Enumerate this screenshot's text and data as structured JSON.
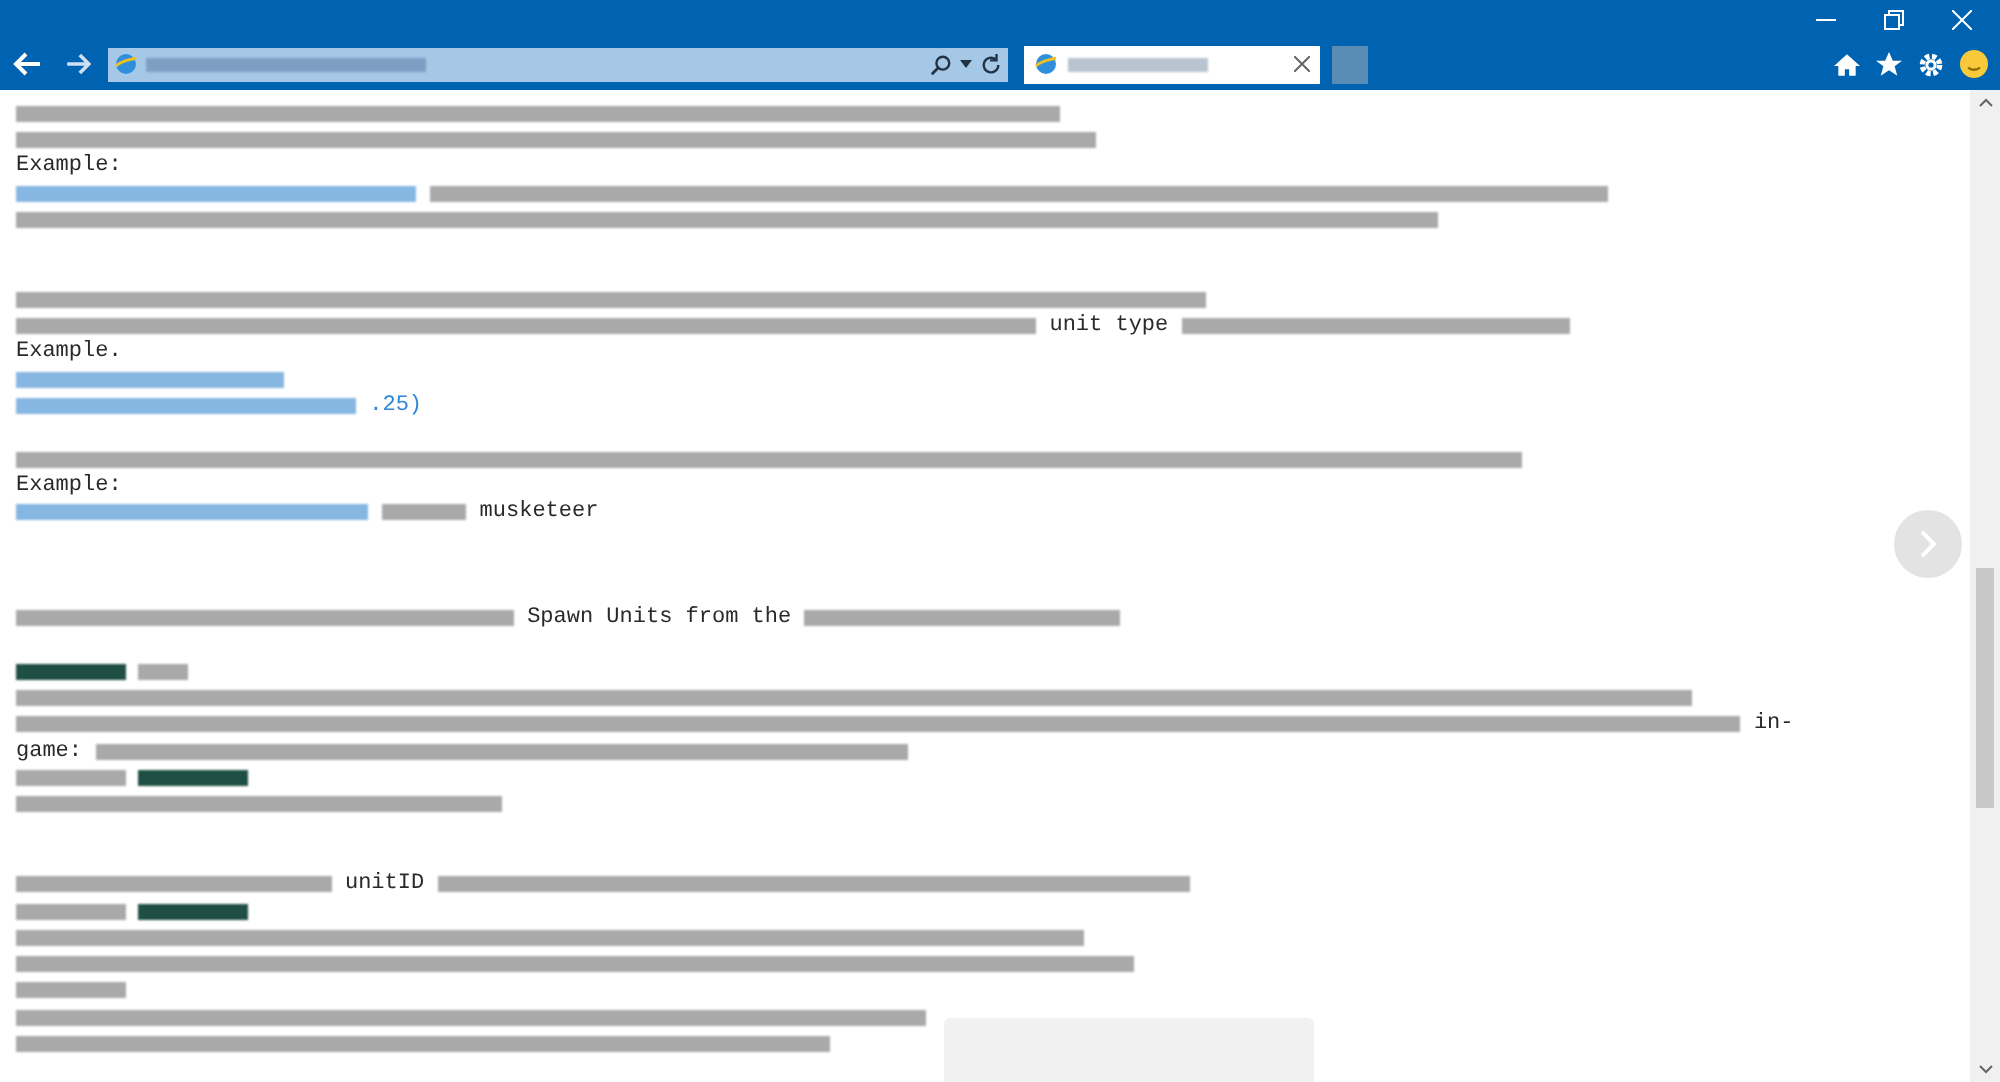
{
  "browser": {
    "tabs": [
      {
        "selected": true
      }
    ]
  },
  "document": {
    "lines": [
      {
        "kind": "code",
        "segments": [
          {
            "kind": "redacted",
            "link": false
          }
        ]
      },
      {
        "kind": "code",
        "segments": [
          {
            "kind": "redacted",
            "link": false
          }
        ]
      },
      {
        "kind": "code",
        "segments": [
          {
            "kind": "text",
            "link": false,
            "text": "Example:"
          }
        ]
      },
      {
        "kind": "code",
        "segments": [
          {
            "kind": "redacted",
            "link": true
          },
          {
            "kind": "redacted",
            "link": false
          }
        ]
      },
      {
        "kind": "code",
        "segments": [
          {
            "kind": "redacted",
            "link": false
          }
        ]
      },
      {
        "kind": "blank"
      },
      {
        "kind": "blank"
      },
      {
        "kind": "code",
        "segments": [
          {
            "kind": "redacted",
            "link": false
          }
        ]
      },
      {
        "kind": "code",
        "segments": [
          {
            "kind": "redacted",
            "link": false
          },
          {
            "kind": "text",
            "link": false,
            "text": "unit type"
          },
          {
            "kind": "redacted",
            "link": false
          }
        ]
      },
      {
        "kind": "code",
        "segments": [
          {
            "kind": "text",
            "link": false,
            "text": "Example."
          }
        ]
      },
      {
        "kind": "code",
        "segments": [
          {
            "kind": "redacted",
            "link": true
          }
        ]
      },
      {
        "kind": "code",
        "segments": [
          {
            "kind": "redacted",
            "link": true
          },
          {
            "kind": "text",
            "link": true,
            "text": ".25)"
          }
        ]
      },
      {
        "kind": "blank"
      },
      {
        "kind": "code",
        "segments": [
          {
            "kind": "redacted",
            "link": false
          }
        ]
      },
      {
        "kind": "code",
        "segments": [
          {
            "kind": "text",
            "link": false,
            "text": "Example:"
          }
        ]
      },
      {
        "kind": "code",
        "segments": [
          {
            "kind": "redacted",
            "link": true
          },
          {
            "kind": "redacted",
            "link": false
          },
          {
            "kind": "text",
            "link": false,
            "text": "musketeer"
          }
        ]
      },
      {
        "kind": "blank"
      },
      {
        "kind": "blank"
      },
      {
        "kind": "blank"
      },
      {
        "kind": "code",
        "segments": [
          {
            "kind": "redacted",
            "link": false
          },
          {
            "kind": "text",
            "link": false,
            "text": "Spawn Units from the"
          },
          {
            "kind": "redacted",
            "link": false
          }
        ]
      },
      {
        "kind": "blank"
      },
      {
        "kind": "code",
        "segments": [
          {
            "kind": "highlighted"
          },
          {
            "kind": "redacted",
            "link": false
          }
        ]
      },
      {
        "kind": "code",
        "segments": [
          {
            "kind": "redacted",
            "link": false
          }
        ]
      },
      {
        "kind": "code",
        "segments": [
          {
            "kind": "redacted",
            "link": false
          },
          {
            "kind": "text",
            "link": false,
            "text": "in-"
          }
        ]
      },
      {
        "kind": "code",
        "segments": [
          {
            "kind": "text",
            "link": false,
            "text": "game:"
          },
          {
            "kind": "redacted",
            "link": false
          }
        ]
      },
      {
        "kind": "code",
        "segments": [
          {
            "kind": "redacted",
            "link": false
          },
          {
            "kind": "highlighted"
          }
        ]
      },
      {
        "kind": "code",
        "segments": [
          {
            "kind": "redacted",
            "link": false
          }
        ]
      },
      {
        "kind": "blank"
      },
      {
        "kind": "blank"
      },
      {
        "kind": "code",
        "segments": [
          {
            "kind": "redacted",
            "link": false
          },
          {
            "kind": "text",
            "link": false,
            "text": "unitID"
          },
          {
            "kind": "redacted",
            "link": false
          }
        ]
      },
      {
        "kind": "code",
        "segments": [
          {
            "kind": "redacted",
            "link": false
          },
          {
            "kind": "highlighted"
          }
        ]
      },
      {
        "kind": "code",
        "segments": [
          {
            "kind": "redacted",
            "link": false
          }
        ]
      },
      {
        "kind": "code",
        "segments": [
          {
            "kind": "redacted",
            "link": false
          }
        ]
      },
      {
        "kind": "code",
        "segments": [
          {
            "kind": "redacted",
            "link": false
          }
        ]
      },
      {
        "kind": "code",
        "segments": [
          {
            "kind": "redacted",
            "link": false
          }
        ]
      },
      {
        "kind": "code",
        "segments": [
          {
            "kind": "redacted",
            "link": false
          }
        ]
      }
    ]
  }
}
